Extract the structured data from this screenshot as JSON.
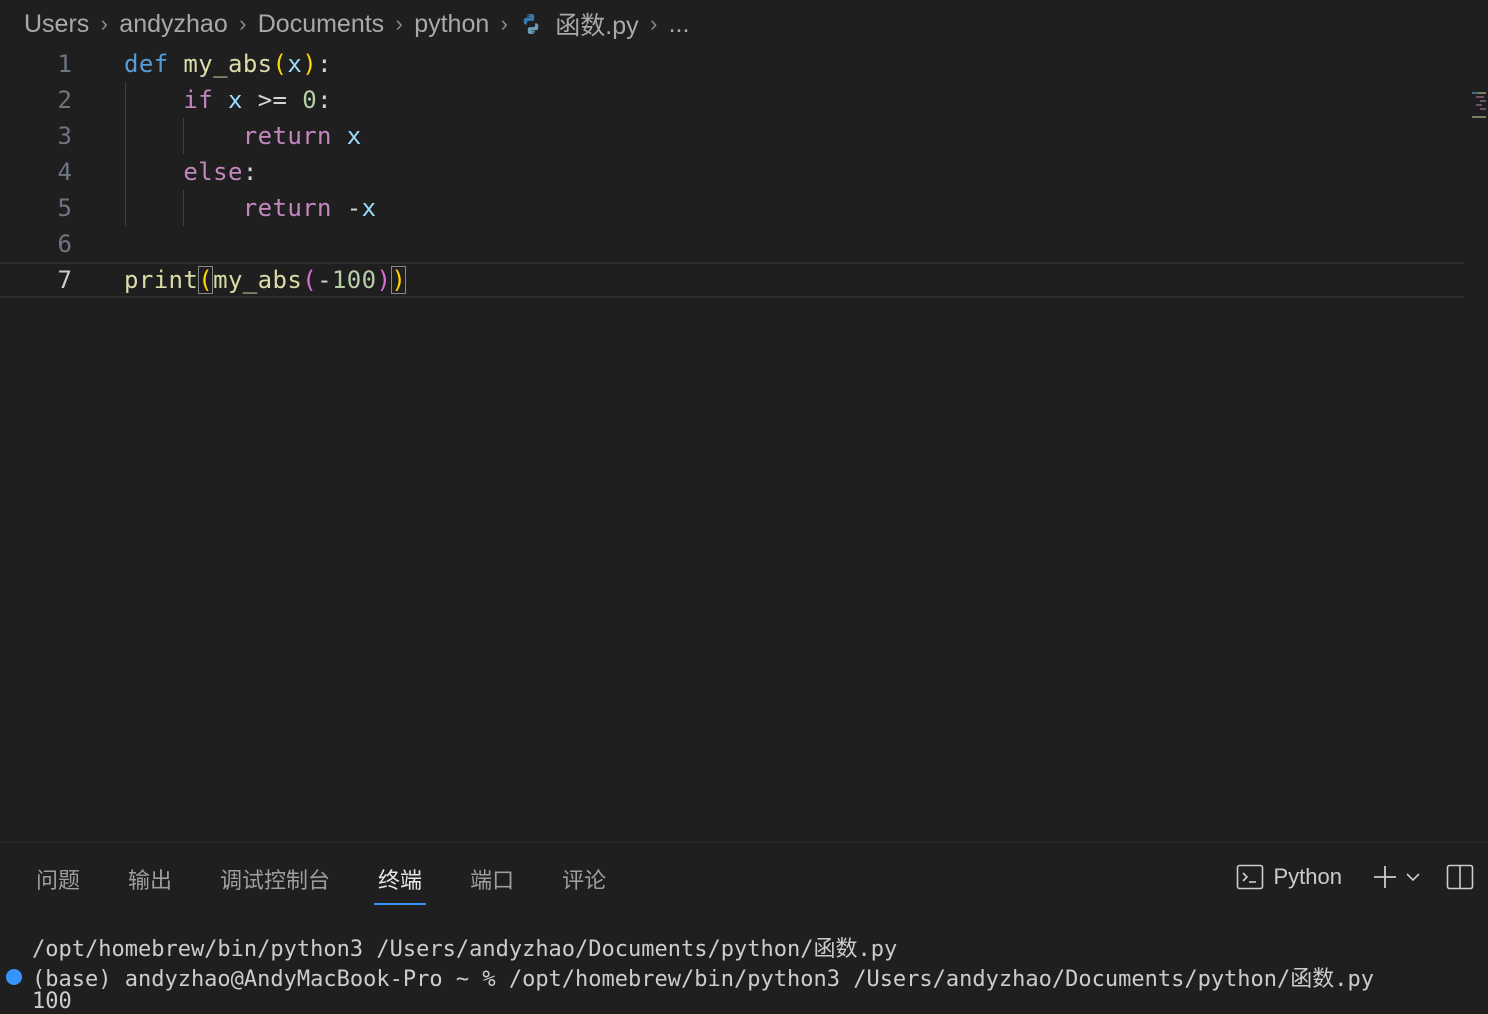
{
  "breadcrumb": {
    "items": [
      "Users",
      "andyzhao",
      "Documents",
      "python",
      "函数.py",
      "..."
    ]
  },
  "editor": {
    "line_numbers": [
      "1",
      "2",
      "3",
      "4",
      "5",
      "6",
      "7"
    ],
    "active_line": 7
  },
  "panel": {
    "tabs": [
      "问题",
      "输出",
      "调试控制台",
      "终端",
      "端口",
      "评论"
    ],
    "active_tab": "终端",
    "terminal_profile": "Python"
  },
  "terminal": {
    "lines": [
      "/opt/homebrew/bin/python3 /Users/andyzhao/Documents/python/函数.py",
      "(base) andyzhao@AndyMacBook-Pro ~ % /opt/homebrew/bin/python3 /Users/andyzhao/Documents/python/函数.py",
      "100"
    ]
  },
  "colors": {
    "background": "#1f1f1f",
    "accent": "#3794ff",
    "keyword_blue": "#569cd6",
    "keyword_purple": "#c586c0",
    "function": "#dcdcaa",
    "variable": "#9cdcfe",
    "number": "#b5cea8"
  }
}
